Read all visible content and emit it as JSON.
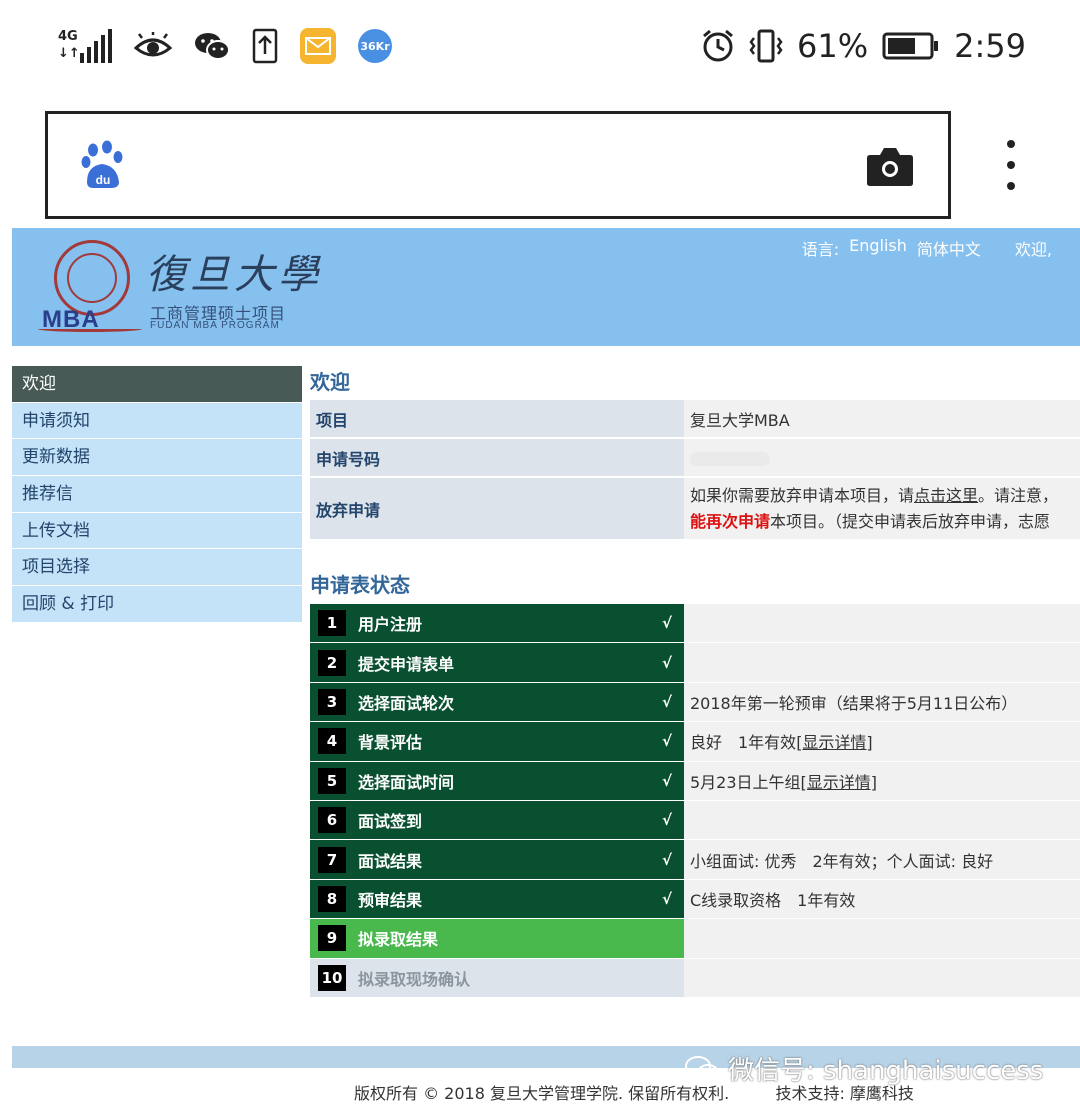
{
  "status_bar": {
    "network": "4G",
    "battery": "61%",
    "time": "2:59",
    "icons": [
      "signal-icon",
      "eye-icon",
      "wechat-icon",
      "upload-icon",
      "mail-icon",
      "36kr-icon",
      "alarm-icon",
      "vibrate-icon",
      "battery-icon"
    ]
  },
  "browser": {
    "icons": [
      "baidu-paw-icon",
      "camera-icon",
      "more-vert-icon"
    ]
  },
  "header": {
    "logo_mark": "MBA",
    "logo_title": "復旦大學",
    "logo_subtitle": "工商管理硕士项目",
    "logo_subtitle_en": "FUDAN MBA PROGRAM",
    "lang_label": "语言:",
    "lang_english": "English",
    "lang_chinese": "简体中文",
    "welcome": "欢迎,"
  },
  "sidebar": {
    "items": [
      {
        "label": "欢迎"
      },
      {
        "label": "申请须知"
      },
      {
        "label": "更新数据"
      },
      {
        "label": "推荐信"
      },
      {
        "label": "上传文档"
      },
      {
        "label": "项目选择"
      },
      {
        "label": "回顾 & 打印"
      }
    ]
  },
  "welcome": {
    "title": "欢迎",
    "rows": [
      {
        "key": "项目",
        "value": "复旦大学MBA"
      },
      {
        "key": "申请号码",
        "value": ""
      },
      {
        "key": "放弃申请",
        "line1_a": "如果你需要放弃申请本项目，请",
        "line1_link": "点击这里",
        "line1_b": "。请注意，",
        "line2_red": "能再次申请",
        "line2_b": "本项目。（提交申请表后放弃申请，志愿"
      }
    ]
  },
  "status": {
    "title": "申请表状态",
    "check_mark": "√",
    "detail_link": "[显示详情]",
    "steps": [
      {
        "num": "1",
        "name": "用户注册",
        "value": ""
      },
      {
        "num": "2",
        "name": "提交申请表单",
        "value": ""
      },
      {
        "num": "3",
        "name": "选择面试轮次",
        "value": "2018年第一轮预审（结果将于5月11日公布）"
      },
      {
        "num": "4",
        "name": "背景评估",
        "value": "良好　1年有效 "
      },
      {
        "num": "5",
        "name": "选择面试时间",
        "value": "5月23日上午组 "
      },
      {
        "num": "6",
        "name": "面试签到",
        "value": ""
      },
      {
        "num": "7",
        "name": "面试结果",
        "value": "小组面试: 优秀　2年有效；个人面试: 良好"
      },
      {
        "num": "8",
        "name": "预审结果",
        "value": "C线录取资格　1年有效"
      },
      {
        "num": "9",
        "name": "拟录取结果",
        "value": ""
      },
      {
        "num": "10",
        "name": "拟录取现场确认",
        "value": ""
      }
    ]
  },
  "footer": {
    "copyright": "版权所有 © 2018 复旦大学管理学院. 保留所有权利.",
    "support": "技术支持: 摩鹰科技",
    "watermark": "微信号: shanghaisuccess"
  }
}
